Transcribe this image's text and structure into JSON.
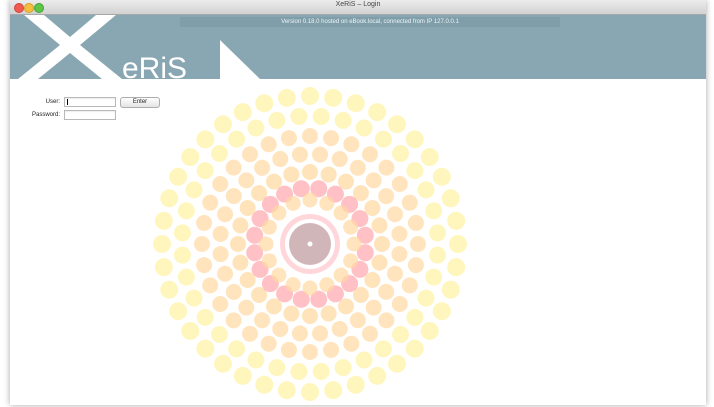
{
  "window": {
    "title": "XeRiS – Login"
  },
  "header": {
    "version_text": "Version 0.18.0 hosted on eBook.local, connected from IP 127.0.0.1",
    "logo_text": "eRiS"
  },
  "login": {
    "user_label": "User:",
    "password_label": "Password:",
    "enter_label": "Enter",
    "user_value": "",
    "password_value": ""
  },
  "colors": {
    "header_bg": "#88a7b2",
    "ring_outer": "#fff3a8",
    "ring_mid": "#ffd9a3",
    "ring_inner": "#ff9fa8",
    "center": "#c9a9ad"
  }
}
